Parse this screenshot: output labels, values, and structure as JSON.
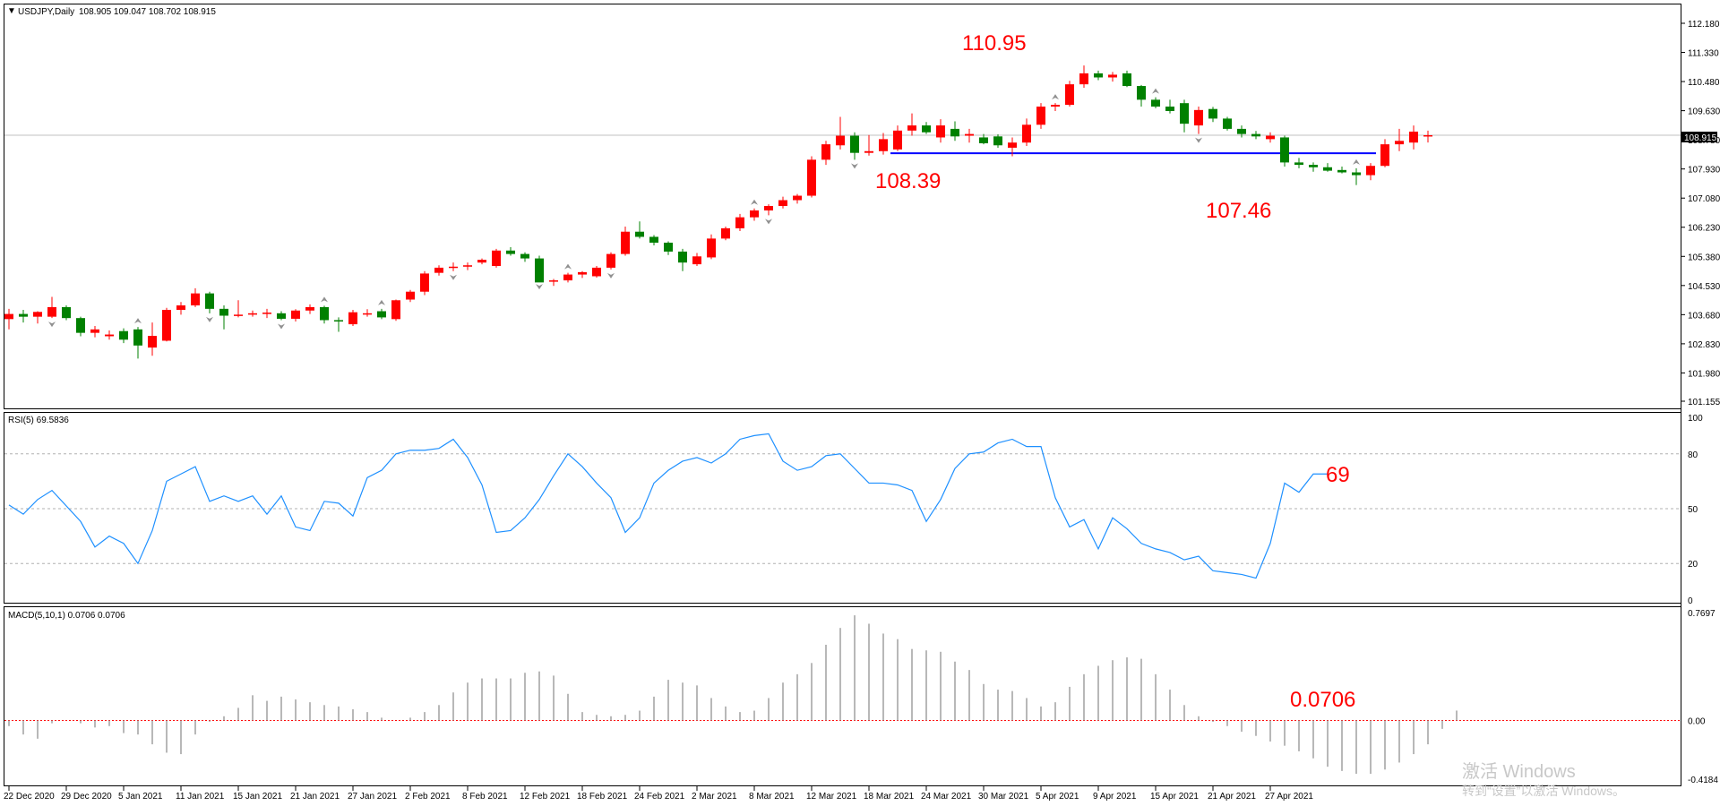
{
  "chart_data": [
    {
      "type": "candlestick",
      "header": {
        "symbol": "USDJPY,Daily",
        "ohlc": "108.905 109.047 108.702 108.915"
      },
      "ylim": [
        101.155,
        112.18
      ],
      "y_ticks": [
        "112.180",
        "111.330",
        "110.480",
        "109.630",
        "108.780",
        "107.930",
        "107.080",
        "106.230",
        "105.380",
        "104.530",
        "103.680",
        "102.830",
        "101.980",
        "101.155"
      ],
      "current_price": "108.915",
      "annotations": {
        "high": "110.95",
        "low": "107.46",
        "neck": "108.39"
      },
      "support_level": 108.39,
      "up_color": "#ff0000",
      "down_color": "#008000",
      "candles": [
        [
          103.55,
          103.85,
          103.25,
          103.7
        ],
        [
          103.7,
          103.82,
          103.45,
          103.62
        ],
        [
          103.62,
          103.78,
          103.42,
          103.76
        ],
        [
          103.62,
          104.2,
          103.58,
          103.9
        ],
        [
          103.9,
          103.95,
          103.52,
          103.58
        ],
        [
          103.58,
          103.62,
          103.05,
          103.15
        ],
        [
          103.15,
          103.35,
          103.02,
          103.25
        ],
        [
          103.05,
          103.22,
          102.95,
          103.1
        ],
        [
          103.2,
          103.28,
          102.85,
          102.95
        ],
        [
          103.25,
          103.32,
          102.4,
          102.78
        ],
        [
          102.72,
          103.45,
          102.48,
          103.06
        ],
        [
          102.92,
          103.88,
          102.9,
          103.82
        ],
        [
          103.82,
          104.05,
          103.68,
          103.95
        ],
        [
          103.95,
          104.45,
          103.9,
          104.3
        ],
        [
          104.3,
          104.35,
          103.72,
          103.85
        ],
        [
          103.85,
          103.95,
          103.25,
          103.65
        ],
        [
          103.65,
          104.1,
          103.6,
          103.68
        ],
        [
          103.68,
          103.8,
          103.62,
          103.72
        ],
        [
          103.7,
          103.85,
          103.58,
          103.74
        ],
        [
          103.72,
          103.78,
          103.52,
          103.56
        ],
        [
          103.56,
          103.84,
          103.48,
          103.8
        ],
        [
          103.8,
          103.98,
          103.7,
          103.9
        ],
        [
          103.9,
          103.94,
          103.42,
          103.52
        ],
        [
          103.52,
          103.6,
          103.18,
          103.5
        ],
        [
          103.4,
          103.82,
          103.35,
          103.75
        ],
        [
          103.7,
          103.84,
          103.62,
          103.72
        ],
        [
          103.78,
          103.85,
          103.55,
          103.6
        ],
        [
          103.55,
          104.12,
          103.5,
          104.1
        ],
        [
          104.12,
          104.4,
          104.05,
          104.35
        ],
        [
          104.35,
          104.95,
          104.25,
          104.88
        ],
        [
          104.9,
          105.12,
          104.82,
          105.05
        ],
        [
          105.05,
          105.2,
          104.95,
          105.08
        ],
        [
          105.08,
          105.2,
          104.98,
          105.12
        ],
        [
          105.2,
          105.32,
          105.15,
          105.28
        ],
        [
          105.1,
          105.6,
          105.05,
          105.55
        ],
        [
          105.55,
          105.65,
          105.4,
          105.45
        ],
        [
          105.45,
          105.5,
          105.22,
          105.32
        ],
        [
          105.32,
          105.4,
          104.68,
          104.62
        ],
        [
          104.65,
          104.72,
          104.52,
          104.68
        ],
        [
          104.68,
          104.9,
          104.62,
          104.85
        ],
        [
          104.85,
          104.95,
          104.75,
          104.92
        ],
        [
          104.8,
          105.1,
          104.76,
          105.05
        ],
        [
          105.05,
          105.5,
          105.0,
          105.45
        ],
        [
          105.45,
          106.25,
          105.4,
          106.1
        ],
        [
          106.1,
          106.4,
          105.9,
          105.95
        ],
        [
          105.95,
          106.0,
          105.7,
          105.78
        ],
        [
          105.78,
          105.82,
          105.42,
          105.52
        ],
        [
          105.52,
          105.6,
          104.95,
          105.2
        ],
        [
          105.15,
          105.48,
          105.1,
          105.38
        ],
        [
          105.35,
          106.02,
          105.3,
          105.9
        ],
        [
          105.9,
          106.25,
          105.85,
          106.2
        ],
        [
          106.2,
          106.62,
          106.12,
          106.52
        ],
        [
          106.52,
          106.78,
          106.42,
          106.72
        ],
        [
          106.72,
          106.9,
          106.58,
          106.85
        ],
        [
          106.85,
          107.12,
          106.78,
          107.02
        ],
        [
          107.02,
          107.2,
          106.92,
          107.15
        ],
        [
          107.15,
          108.3,
          107.1,
          108.2
        ],
        [
          108.2,
          108.75,
          108.05,
          108.65
        ],
        [
          108.62,
          109.45,
          108.5,
          108.9
        ],
        [
          108.9,
          109.0,
          108.2,
          108.4
        ],
        [
          108.4,
          108.92,
          108.32,
          108.45
        ],
        [
          108.45,
          108.98,
          108.35,
          108.8
        ],
        [
          108.5,
          109.2,
          108.45,
          109.05
        ],
        [
          109.05,
          109.55,
          108.9,
          109.2
        ],
        [
          109.2,
          109.3,
          108.95,
          109.0
        ],
        [
          108.85,
          109.38,
          108.7,
          109.2
        ],
        [
          109.1,
          109.32,
          108.75,
          108.88
        ],
        [
          108.9,
          109.1,
          108.7,
          108.95
        ],
        [
          108.85,
          108.95,
          108.65,
          108.68
        ],
        [
          108.88,
          108.94,
          108.55,
          108.62
        ],
        [
          108.55,
          108.85,
          108.3,
          108.7
        ],
        [
          108.7,
          109.4,
          108.6,
          109.22
        ],
        [
          109.22,
          109.85,
          109.1,
          109.75
        ],
        [
          109.75,
          109.85,
          109.62,
          109.8
        ],
        [
          109.8,
          110.5,
          109.75,
          110.4
        ],
        [
          110.4,
          110.95,
          110.3,
          110.72
        ],
        [
          110.72,
          110.8,
          110.52,
          110.6
        ],
        [
          110.6,
          110.76,
          110.48,
          110.68
        ],
        [
          110.72,
          110.8,
          110.32,
          110.35
        ],
        [
          110.35,
          110.38,
          109.75,
          109.95
        ],
        [
          109.95,
          110.02,
          109.7,
          109.75
        ],
        [
          109.75,
          109.95,
          109.55,
          109.62
        ],
        [
          109.85,
          109.95,
          109.0,
          109.25
        ],
        [
          109.2,
          109.75,
          108.95,
          109.65
        ],
        [
          109.68,
          109.74,
          109.3,
          109.4
        ],
        [
          109.4,
          109.45,
          109.05,
          109.1
        ],
        [
          109.1,
          109.2,
          108.85,
          108.95
        ],
        [
          108.95,
          109.04,
          108.8,
          108.88
        ],
        [
          108.8,
          109.0,
          108.7,
          108.9
        ],
        [
          108.85,
          108.9,
          108.0,
          108.12
        ],
        [
          108.12,
          108.25,
          107.95,
          108.05
        ],
        [
          108.05,
          108.12,
          107.85,
          107.98
        ],
        [
          107.98,
          108.1,
          107.85,
          107.88
        ],
        [
          107.9,
          108.0,
          107.8,
          107.83
        ],
        [
          107.83,
          107.95,
          107.46,
          107.75
        ],
        [
          107.75,
          108.1,
          107.6,
          108.02
        ],
        [
          108.02,
          108.8,
          107.98,
          108.65
        ],
        [
          108.65,
          109.1,
          108.45,
          108.75
        ],
        [
          108.7,
          109.2,
          108.5,
          109.02
        ],
        [
          108.905,
          109.047,
          108.702,
          108.915
        ]
      ],
      "fractals_up": [
        9,
        22,
        26,
        39,
        52,
        73,
        80,
        94
      ],
      "fractals_down": [
        3,
        14,
        19,
        31,
        37,
        42,
        53,
        59,
        83
      ],
      "x_tick_labels": [
        "22 Dec 2020",
        "29 Dec 2020",
        "5 Jan 2021",
        "11 Jan 2021",
        "15 Jan 2021",
        "21 Jan 2021",
        "27 Jan 2021",
        "2 Feb 2021",
        "8 Feb 2021",
        "12 Feb 2021",
        "18 Feb 2021",
        "24 Feb 2021",
        "2 Mar 2021",
        "8 Mar 2021",
        "12 Mar 2021",
        "18 Mar 2021",
        "24 Mar 2021",
        "30 Mar 2021",
        "5 Apr 2021",
        "9 Apr 2021",
        "15 Apr 2021",
        "21 Apr 2021",
        "27 Apr 2021"
      ],
      "x_tick_index": [
        0,
        4,
        8,
        12,
        16,
        20,
        24,
        28,
        32,
        36,
        40,
        44,
        48,
        52,
        56,
        60,
        64,
        68,
        72,
        76,
        80,
        84,
        88
      ]
    },
    {
      "type": "line",
      "title": "RSI(5) 69.5836",
      "ylim": [
        0,
        100
      ],
      "y_ticks": [
        "100",
        "80",
        "50",
        "20",
        "0"
      ],
      "levels": [
        80,
        50,
        20
      ],
      "annotation": "69",
      "color": "#1e90ff",
      "values": [
        52,
        47,
        55,
        60,
        43,
        29,
        35,
        31,
        20,
        38,
        65,
        69,
        73,
        54,
        57,
        54,
        57,
        47,
        57,
        40,
        38,
        54,
        53,
        46,
        67,
        71,
        80,
        82,
        82,
        83,
        88,
        78,
        63,
        37,
        38,
        45,
        55,
        68,
        80,
        73,
        64,
        56,
        37,
        45,
        64,
        71,
        76,
        78,
        75,
        80,
        88,
        90,
        91,
        76,
        71,
        73,
        79,
        80,
        72,
        64,
        64,
        63,
        60,
        43,
        55,
        72,
        80,
        81,
        86,
        88,
        84,
        84,
        56,
        40,
        44,
        28,
        45,
        39,
        31,
        28,
        26,
        22,
        24,
        16,
        15,
        14,
        12,
        31,
        64,
        59,
        69,
        69
      ],
      "rsi_x_index": [
        0,
        1,
        2,
        3,
        5,
        6,
        7,
        8,
        9,
        10,
        11,
        12,
        13,
        14,
        15,
        16,
        17,
        18,
        19,
        20,
        21,
        22,
        23,
        24,
        25,
        26,
        27,
        28,
        29,
        30,
        31,
        32,
        33,
        34,
        35,
        36,
        37,
        38,
        39,
        40,
        41,
        42,
        43,
        44,
        45,
        46,
        47,
        48,
        49,
        50,
        51,
        52,
        53,
        54,
        55,
        56,
        57,
        58,
        59,
        60,
        61,
        62,
        63,
        64,
        65,
        66,
        67,
        68,
        69,
        70,
        71,
        72,
        73,
        74,
        75,
        76,
        77,
        78,
        79,
        80,
        81,
        82,
        83,
        84,
        85,
        86,
        87,
        88,
        89,
        90,
        91,
        92
      ]
    },
    {
      "type": "histogram",
      "title": "MACD(5,10,1) 0.0706 0.0706",
      "ylim": [
        -0.4184,
        0.7697
      ],
      "y_ticks": [
        "0.7697",
        "0.00",
        "-0.4184"
      ],
      "annotation": "0.0706",
      "color": "#a0a0a0",
      "values": [
        -0.04,
        -0.1,
        -0.13,
        -0.02,
        0,
        -0.02,
        -0.05,
        -0.04,
        -0.09,
        -0.1,
        -0.17,
        -0.23,
        -0.24,
        -0.1,
        -0.01,
        0.03,
        0.09,
        0.18,
        0.14,
        0.17,
        0.15,
        0.13,
        0.11,
        0.1,
        0.08,
        0.06,
        0.02,
        0,
        0.02,
        0.06,
        0.11,
        0.2,
        0.27,
        0.3,
        0.3,
        0.3,
        0.34,
        0.35,
        0.32,
        0.19,
        0.06,
        0.04,
        0.03,
        0.04,
        0.07,
        0.17,
        0.29,
        0.27,
        0.25,
        0.16,
        0.1,
        0.06,
        0.07,
        0.16,
        0.27,
        0.33,
        0.41,
        0.54,
        0.66,
        0.75,
        0.69,
        0.62,
        0.58,
        0.51,
        0.5,
        0.49,
        0.42,
        0.36,
        0.26,
        0.22,
        0.21,
        0.16,
        0.1,
        0.13,
        0.24,
        0.33,
        0.39,
        0.43,
        0.45,
        0.44,
        0.33,
        0.22,
        0.11,
        0.03,
        -0.01,
        -0.04,
        -0.08,
        -0.11,
        -0.15,
        -0.18,
        -0.22,
        -0.27,
        -0.33,
        -0.36,
        -0.38,
        -0.38,
        -0.35,
        -0.3,
        -0.24,
        -0.17,
        -0.06,
        0.0706
      ],
      "macd_x_index": [
        0,
        1,
        2,
        3,
        4,
        5,
        6,
        7,
        8,
        9,
        10,
        11,
        12,
        13,
        14,
        15,
        16,
        17,
        18,
        19,
        20,
        21,
        22,
        23,
        24,
        25,
        26,
        27,
        28,
        29,
        30,
        31,
        32,
        33,
        34,
        35,
        36,
        37,
        38,
        39,
        40,
        41,
        42,
        43,
        44,
        45,
        46,
        47,
        48,
        49,
        50,
        51,
        52,
        53,
        54,
        55,
        56,
        57,
        58,
        59,
        60,
        61,
        62,
        63,
        64,
        65,
        66,
        67,
        68,
        69,
        70,
        71,
        72,
        73,
        74,
        75,
        76,
        77,
        78,
        79,
        80,
        81,
        82,
        83,
        84,
        85,
        86,
        87,
        88,
        89,
        90,
        91,
        92,
        93,
        94,
        95,
        96,
        97,
        98,
        99,
        100,
        101
      ]
    }
  ],
  "watermark": {
    "line1": "激活 Windows",
    "line2": "转到“设置”以激活 Windows。"
  }
}
